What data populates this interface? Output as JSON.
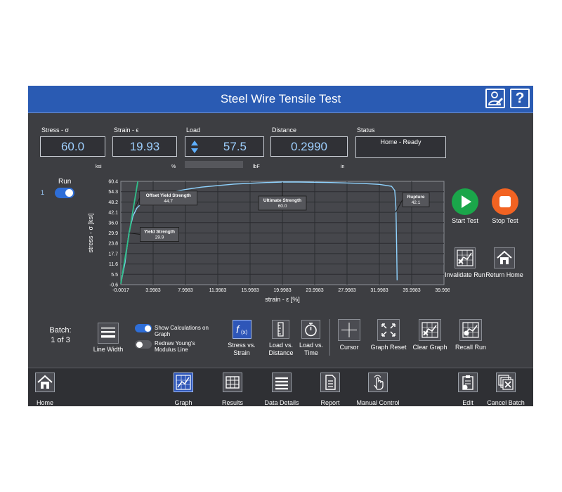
{
  "header": {
    "title": "Steel Wire Tensile Test",
    "help_label": "?"
  },
  "readouts": {
    "stress": {
      "label": "Stress - σ",
      "value": "60.0",
      "unit": "ksi"
    },
    "strain": {
      "label": "Strain - ϵ",
      "value": "19.93",
      "unit": "%"
    },
    "load": {
      "label": "Load",
      "value": "57.5",
      "unit": "lbF"
    },
    "distance": {
      "label": "Distance",
      "value": "0.2990",
      "unit": "in"
    },
    "status": {
      "label": "Status",
      "value": "Home - Ready"
    }
  },
  "run": {
    "label": "Run",
    "number": "1",
    "enabled": true
  },
  "chart_data": {
    "type": "line",
    "xlabel": "strain - ε [%]",
    "ylabel": "stress - σ [ksi]",
    "x_ticks": [
      "-0.0017",
      "3.9983",
      "7.9983",
      "11.9983",
      "15.9983",
      "19.9983",
      "23.9983",
      "27.9983",
      "31.9983",
      "35.9983",
      "39.9983"
    ],
    "y_ticks": [
      "60.4",
      "54.3",
      "48.2",
      "42.1",
      "36.0",
      "29.9",
      "23.8",
      "17.7",
      "11.6",
      "5.5",
      "-0.6"
    ],
    "xlim": [
      -0.0017,
      39.9983
    ],
    "ylim": [
      -0.6,
      60.4
    ],
    "series": [
      {
        "color": "#8fd3ff",
        "x": [
          0,
          0.5,
          1.0,
          1.5,
          2.0,
          2.5,
          3.0,
          4.0,
          6.0,
          8.0,
          10.0,
          14.0,
          18.0,
          20.0,
          22.0,
          26.0,
          30.0,
          32.0,
          33.5,
          33.9,
          34.05,
          34.15,
          34.2
        ],
        "y": [
          0,
          12.0,
          29.9,
          40.0,
          44.7,
          47.0,
          48.8,
          51.0,
          53.8,
          55.6,
          57.0,
          58.8,
          59.7,
          60.0,
          60.0,
          59.7,
          59.1,
          58.6,
          57.5,
          55.0,
          45.0,
          20.0,
          2.0
        ]
      },
      {
        "color": "#2fbf8a",
        "x": [
          0.0,
          2.1
        ],
        "y": [
          0.0,
          60.4
        ]
      }
    ],
    "annotations": [
      {
        "title": "Offset Yield Strength",
        "value": "44.7",
        "x": 1.8,
        "y": 44.7
      },
      {
        "title": "Yield Strength",
        "value": "29.9",
        "x": 1.0,
        "y": 29.9
      },
      {
        "title": "Ultimate Strength",
        "value": "60.0",
        "x": 20.0,
        "y": 60.0
      },
      {
        "title": "Rupture",
        "value": "42.1",
        "x": 34.0,
        "y": 42.1
      }
    ],
    "grid": true
  },
  "actions": {
    "start_test": "Start Test",
    "stop_test": "Stop Test",
    "invalidate_run": "Invalidate Run",
    "return_home": "Return Home"
  },
  "toolbar": {
    "batch_label": "Batch:",
    "batch_value": "1 of 3",
    "line_width": "Line Width",
    "show_calc": "Show Calculations on Graph",
    "show_calc_on": true,
    "redraw_youngs": "Redraw Young's Modulus Line",
    "redraw_youngs_on": false,
    "stress_vs_strain": "Stress vs. Strain",
    "load_vs_distance": "Load vs. Distance",
    "load_vs_time": "Load vs. Time",
    "cursor": "Cursor",
    "graph_reset": "Graph Reset",
    "clear_graph": "Clear Graph",
    "recall_run": "Recall Run"
  },
  "nav": {
    "home": "Home",
    "graph": "Graph",
    "results": "Results",
    "data_details": "Data Details",
    "report": "Report",
    "manual_control": "Manual Control",
    "edit": "Edit",
    "cancel_batch": "Cancel Batch"
  },
  "colors": {
    "title_bar": "#2a5bb3",
    "panel": "#3d3e42",
    "accent_blue": "#2e6ed8",
    "start_green": "#1aa64a",
    "stop_orange": "#f26322",
    "stress_curve": "#8fd3ff",
    "modulus_line": "#2fbf8a"
  }
}
